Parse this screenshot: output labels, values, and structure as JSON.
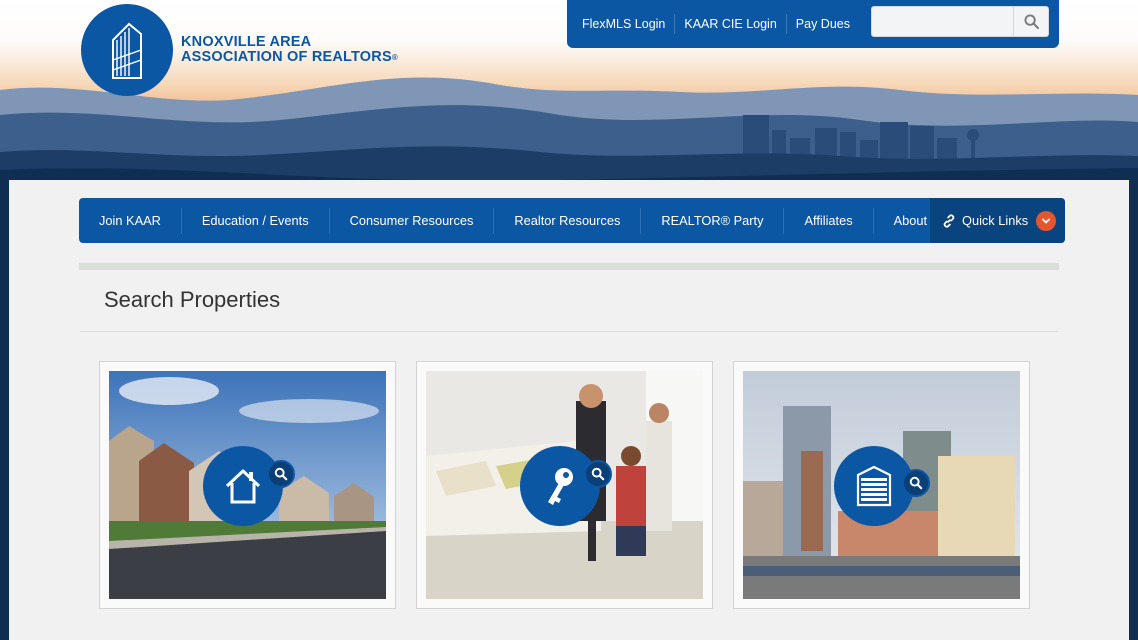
{
  "logo": {
    "line1": "KNOXVILLE AREA",
    "line2": "ASSOCIATION OF REALTORS",
    "reg": "®"
  },
  "utility": {
    "links": [
      "FlexMLS Login",
      "KAAR CIE Login",
      "Pay Dues"
    ],
    "search_placeholder": "",
    "search_icon": "magnifier-icon"
  },
  "nav": {
    "items": [
      "Join KAAR",
      "Education / Events",
      "Consumer Resources",
      "Realtor Resources",
      "REALTOR® Party",
      "Affiliates",
      "About KAAR"
    ],
    "quick_links": "Quick Links",
    "quick_icon": "link-icon",
    "chevron_icon": "chevron-down-icon"
  },
  "main": {
    "title": "Search Properties",
    "cards": [
      {
        "icon": "house-icon",
        "search_icon": "magnifier-icon"
      },
      {
        "icon": "key-icon",
        "search_icon": "magnifier-icon"
      },
      {
        "icon": "building-icon",
        "search_icon": "magnifier-icon"
      }
    ]
  },
  "colors": {
    "brand_blue": "#0c57a3",
    "dark_navy": "#0f2e52",
    "accent_orange": "#e4572e",
    "page_bg": "#f1f1f1"
  }
}
